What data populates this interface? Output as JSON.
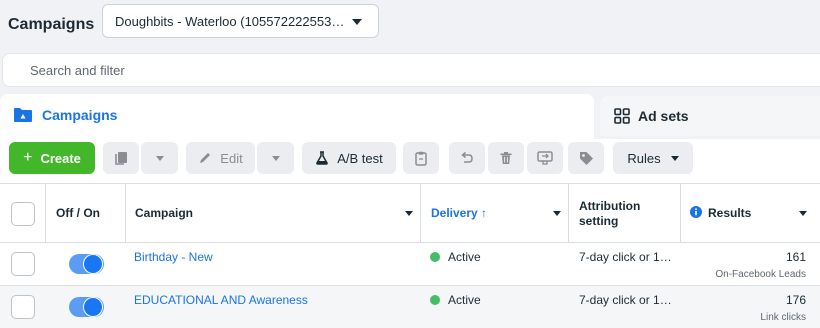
{
  "header": {
    "title": "Campaigns",
    "account_selector": "Doughbits - Waterloo (105572222553…"
  },
  "search": {
    "placeholder": "Search and filter"
  },
  "tabs": {
    "campaigns": "Campaigns",
    "ad_sets": "Ad sets"
  },
  "toolbar": {
    "create": "Create",
    "edit": "Edit",
    "ab_test": "A/B test",
    "rules": "Rules"
  },
  "table": {
    "columns": {
      "off_on": "Off / On",
      "campaign": "Campaign",
      "delivery": "Delivery ↑",
      "attribution": "Attribution setting",
      "results": "Results"
    },
    "rows": [
      {
        "on": true,
        "campaign": "Birthday - New",
        "delivery": "Active",
        "attribution": "7-day click or 1…",
        "results": "161",
        "results_type": "On-Facebook Leads"
      },
      {
        "on": true,
        "campaign": "EDUCATIONAL AND Awareness",
        "delivery": "Active",
        "attribution": "7-day click or 1…",
        "results": "176",
        "results_type": "Link clicks"
      }
    ]
  },
  "colors": {
    "accent": "#1b74e4",
    "create_button": "#42b72a",
    "active_dot": "#45bd62",
    "toggle_on": "#1877f2"
  },
  "icons": [
    "folder-icon",
    "grid-icon",
    "duplicate-icon",
    "pencil-icon",
    "flask-icon",
    "clipboard-icon",
    "undo-icon",
    "trash-icon",
    "compare-icon",
    "tag-icon",
    "info-icon"
  ]
}
